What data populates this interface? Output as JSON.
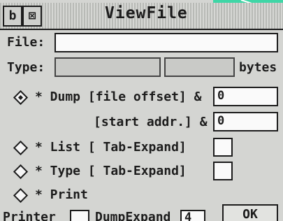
{
  "window": {
    "title": "ViewFile",
    "back_icon_glyph": "b",
    "close_icon_glyph": "⊠"
  },
  "colors": {
    "desktop_accent": "#3fd6a6",
    "window_bg": "#d4d5d2"
  },
  "file": {
    "label": "File:",
    "value": ""
  },
  "type": {
    "label": "Type:",
    "value_left": "",
    "value_right": "",
    "units": "bytes"
  },
  "options": {
    "dump": {
      "label": "* Dump [file offset] &",
      "selected": true,
      "offset_value": "0"
    },
    "start_addr": {
      "label": "[start addr.] &",
      "value": "0"
    },
    "list": {
      "label": "* List [ Tab-Expand]"
    },
    "type": {
      "label": "* Type [ Tab-Expand]"
    },
    "print": {
      "label": "* Print"
    }
  },
  "footer": {
    "printer_label": "Printer",
    "dumpexpand_label": "DumpExpand",
    "dumpexpand_value": "4",
    "ok_label": "OK"
  }
}
